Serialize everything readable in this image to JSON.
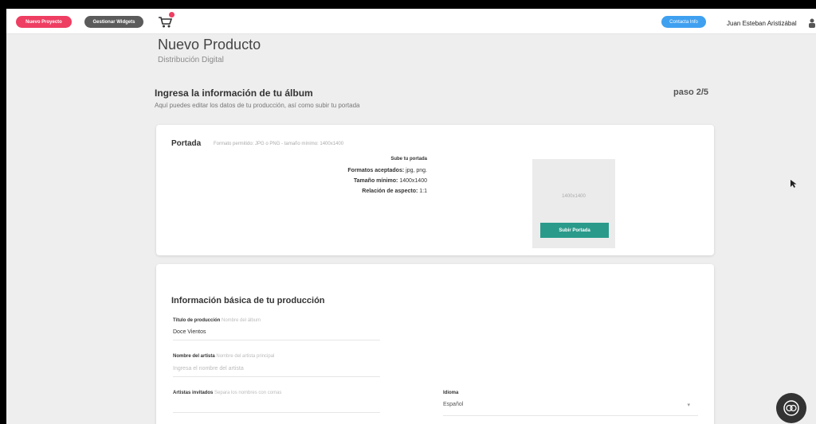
{
  "topbar": {
    "new_project_label": "Nuevo Proyecto",
    "widgets_label": "Gestionar Widgets",
    "contact_label": "Contacta Info",
    "user_name": "Juan Esteban Aristizábal",
    "accent": "#ee3e62",
    "blue": "#3fa0f0"
  },
  "header": {
    "title": "Nuevo Producto",
    "subtitle": "Distribución Digital"
  },
  "section": {
    "title": "Ingresa la información de tu álbum",
    "description": "Aquí puedes editar los datos de tu producción, así como subir tu portada",
    "step": "paso 2/5"
  },
  "portada": {
    "title": "Portada",
    "hint": "Formato permitido: JPG o PNG - tamaño mínimo: 1400x1400",
    "upload_hint": "Sube tu portada",
    "formats_label": "Formatos aceptados:",
    "formats_value": "jpg, png.",
    "min_size_label": "Tamaño mínimo:",
    "min_size_value": "1400x1400",
    "aspect_label": "Relación de aspecto:",
    "aspect_value": "1:1",
    "preview_text": "1400x1400",
    "upload_button": "Subir Portada",
    "button_color": "#2a9b8b"
  },
  "basic_info": {
    "title": "Información básica de tu producción",
    "production_title_label": "Título de producción",
    "production_title_hint": "Nombre del álbum",
    "production_title_value": "Doce Vientos",
    "artist_label": "Nombre del artista",
    "artist_hint": "Nombre del artista principal",
    "artist_placeholder": "Ingresa el nombre del artista",
    "guests_label": "Artistas invitados",
    "guests_hint": "Separa los nombres con comas",
    "language_label": "Idioma",
    "language_value": "Español"
  }
}
